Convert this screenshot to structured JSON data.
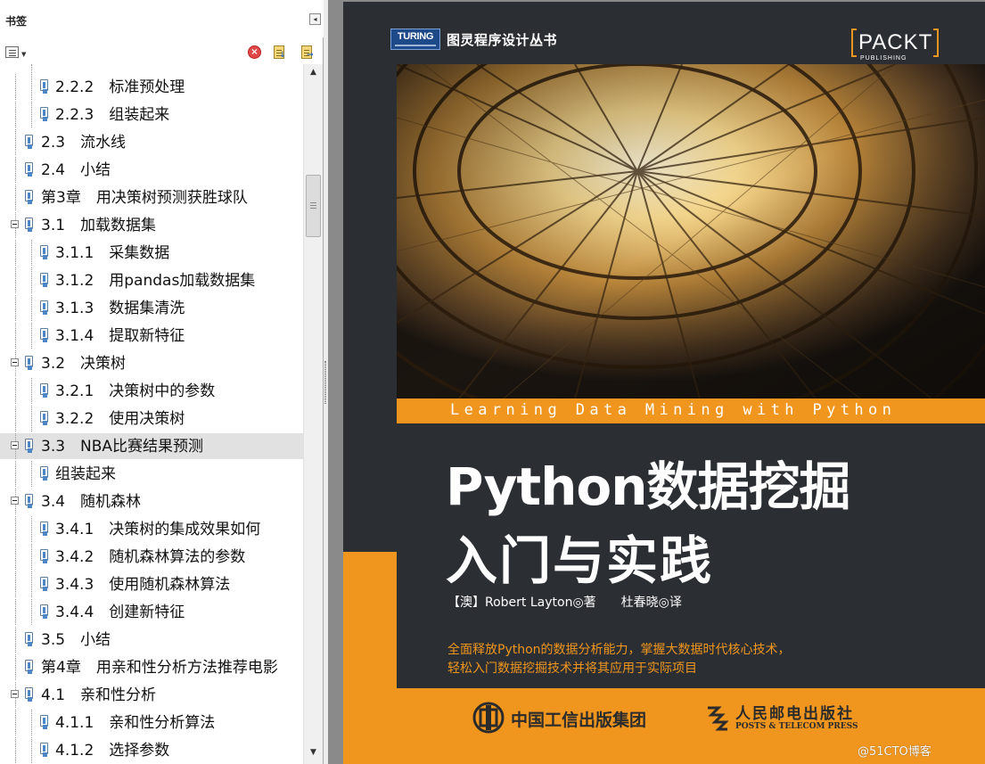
{
  "panel": {
    "title": "书签",
    "collapse_glyph": "◂",
    "toolbar": {
      "options_icon": "options-menu-icon",
      "delete_icon": "delete-bookmark-icon",
      "delete_glyph": "×",
      "expand_icon": "expand-bookmark-icon",
      "new_icon": "new-bookmark-icon"
    }
  },
  "bookmarks": [
    {
      "label": "2.2.2　标准预处理",
      "level": 2
    },
    {
      "label": "2.2.3　组装起来",
      "level": 2
    },
    {
      "label": "2.3　流水线",
      "level": 1
    },
    {
      "label": "2.4　小结",
      "level": 1
    },
    {
      "label": "第3章　用决策树预测获胜球队",
      "level": 1
    },
    {
      "label": "3.1　加载数据集",
      "level": 1,
      "expanded": true
    },
    {
      "label": "3.1.1　采集数据",
      "level": 2
    },
    {
      "label": "3.1.2　用pandas加载数据集",
      "level": 2
    },
    {
      "label": "3.1.3　数据集清洗",
      "level": 2
    },
    {
      "label": "3.1.4　提取新特征",
      "level": 2
    },
    {
      "label": "3.2　决策树",
      "level": 1,
      "expanded": true
    },
    {
      "label": "3.2.1　决策树中的参数",
      "level": 2
    },
    {
      "label": "3.2.2　使用决策树",
      "level": 2
    },
    {
      "label": "3.3　NBA比赛结果预测",
      "level": 1,
      "expanded": true,
      "selected": true
    },
    {
      "label": "组装起来",
      "level": 2
    },
    {
      "label": "3.4　随机森林",
      "level": 1,
      "expanded": true
    },
    {
      "label": "3.4.1　决策树的集成效果如何",
      "level": 2
    },
    {
      "label": "3.4.2　随机森林算法的参数",
      "level": 2
    },
    {
      "label": "3.4.3　使用随机森林算法",
      "level": 2
    },
    {
      "label": "3.4.4　创建新特征",
      "level": 2
    },
    {
      "label": "3.5　小结",
      "level": 1
    },
    {
      "label": "第4章　用亲和性分析方法推荐电影",
      "level": 1
    },
    {
      "label": "4.1　亲和性分析",
      "level": 1,
      "expanded": true
    },
    {
      "label": "4.1.1　亲和性分析算法",
      "level": 2
    },
    {
      "label": "4.1.2　选择参数",
      "level": 2
    }
  ],
  "scrollbar": {
    "up_glyph": "▲",
    "down_glyph": "▼"
  },
  "cover": {
    "publisher_logo_text": "TURING",
    "series_name": "图灵程序设计丛书",
    "packt_name": "PACKT",
    "packt_sub": "PUBLISHING",
    "subtitle_en": "Learning Data Mining with Python",
    "title_line1": "Python数据挖掘",
    "title_line2": "入门与实践",
    "authors": "【澳】Robert  Layton◎著　　杜春晓◎译",
    "tagline_line1": "全面释放Python的数据分析能力，掌握大数据时代核心技术，",
    "tagline_line2": "轻松入门数据挖掘技术并将其应用于实际项目",
    "publisher1": "中国工信出版集团",
    "publisher2": "人民邮电出版社",
    "publisher2_en": "POSTS & TELECOM PRESS",
    "colors": {
      "accent": "#f0961e",
      "background": "#2b2e33"
    }
  },
  "watermark": "@51CTO博客"
}
